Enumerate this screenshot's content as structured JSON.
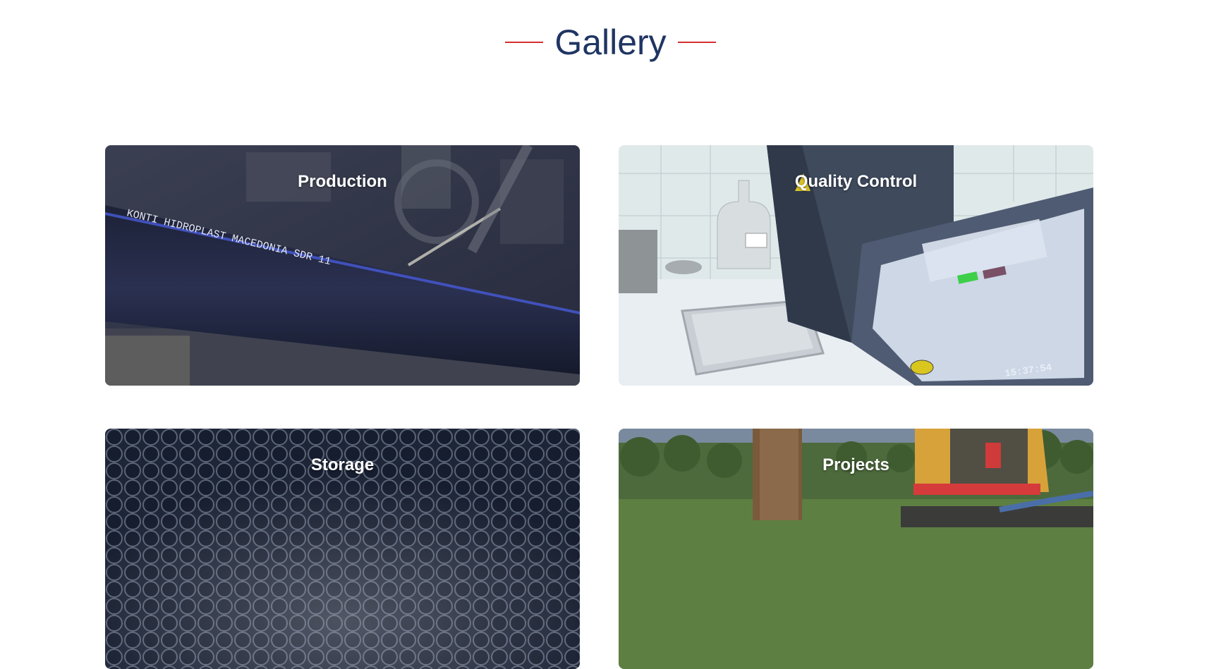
{
  "gallery": {
    "title": "Gallery",
    "accent_color": "#d32f2f",
    "title_color": "#1f3563"
  },
  "cards": [
    {
      "label": "Production",
      "image": "pipe-production-photo",
      "pipe_print": "KONTI HIDROPLAST MACEDONIA SDR 11"
    },
    {
      "label": "Quality Control",
      "image": "lab-testing-machine-photo",
      "screen_time": "15:37:54"
    },
    {
      "label": "Storage",
      "image": "stacked-pipes-photo"
    },
    {
      "label": "Projects",
      "image": "excavator-photo"
    }
  ]
}
